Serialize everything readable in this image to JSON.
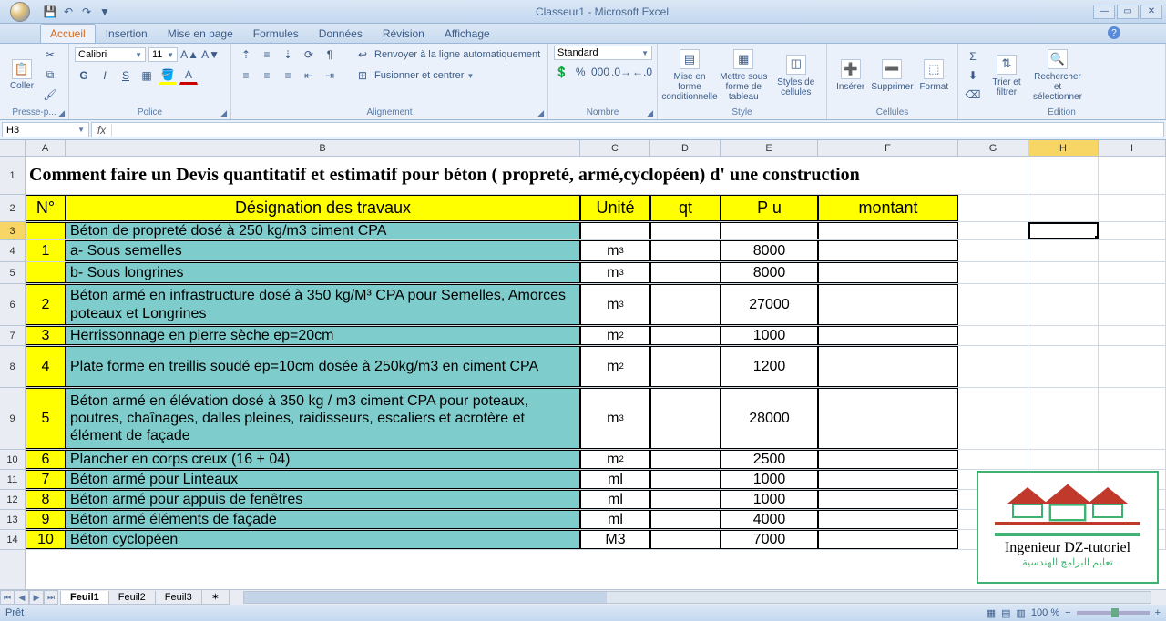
{
  "window": {
    "title": "Classeur1 - Microsoft Excel"
  },
  "qat": {
    "save": "💾",
    "undo": "↶",
    "redo": "↷"
  },
  "tabs": [
    "Accueil",
    "Insertion",
    "Mise en page",
    "Formules",
    "Données",
    "Révision",
    "Affichage"
  ],
  "active_tab": "Accueil",
  "ribbon": {
    "clipboard": {
      "paste": "Coller",
      "label": "Presse-p..."
    },
    "font": {
      "name": "Calibri",
      "size": "11",
      "label": "Police"
    },
    "align": {
      "wrap": "Renvoyer à la ligne automatiquement",
      "merge": "Fusionner et centrer",
      "label": "Alignement"
    },
    "number": {
      "format": "Standard",
      "label": "Nombre"
    },
    "style": {
      "cond": "Mise en forme conditionnelle",
      "fmt_table": "Mettre sous forme de tableau",
      "cell_styles": "Styles de cellules",
      "label": "Style"
    },
    "cells": {
      "insert": "Insérer",
      "delete": "Supprimer",
      "format": "Format",
      "label": "Cellules"
    },
    "editing": {
      "sort": "Trier et filtrer",
      "find": "Rechercher et sélectionner",
      "label": "Édition"
    }
  },
  "namebox": "H3",
  "formula": "",
  "columns": [
    "A",
    "B",
    "C",
    "D",
    "E",
    "F",
    "G",
    "H",
    "I"
  ],
  "rows": [
    "1",
    "2",
    "3",
    "4",
    "5",
    "6",
    "7",
    "8",
    "9",
    "10",
    "11",
    "12",
    "13",
    "14"
  ],
  "title_cell": "Comment faire un Devis quantitatif et estimatif pour béton ( propreté, armé,cyclopéen) d' une construction",
  "headers": {
    "no": "N°",
    "design": "Désignation des travaux",
    "unite": "Unité",
    "qt": "qt",
    "pu": "P u",
    "montant": "montant"
  },
  "data": [
    {
      "n": "",
      "d": "Béton de propreté dosé à 250 kg/m3 ciment CPA",
      "u": "",
      "qt": "",
      "pu": "",
      "m": ""
    },
    {
      "n": "1",
      "d": "a- Sous semelles",
      "u": "m³",
      "qt": "",
      "pu": "8000",
      "m": ""
    },
    {
      "n": "",
      "d": "b- Sous longrines",
      "u": "m³",
      "qt": "",
      "pu": "8000",
      "m": ""
    },
    {
      "n": "2",
      "d": "Béton armé en infrastructure dosé à 350 kg/M³ CPA pour Semelles, Amorces poteaux et Longrines",
      "u": "m³",
      "qt": "",
      "pu": "27000",
      "m": ""
    },
    {
      "n": "3",
      "d": "Herrissonnage en pierre sèche ep=20cm",
      "u": "m²",
      "qt": "",
      "pu": "1000",
      "m": ""
    },
    {
      "n": "4",
      "d": "Plate forme en treillis soudé ep=10cm dosée à 250kg/m3 en ciment CPA",
      "u": "m²",
      "qt": "",
      "pu": "1200",
      "m": ""
    },
    {
      "n": "5",
      "d": "Béton armé en élévation dosé à 350 kg / m3 ciment CPA pour poteaux, poutres, chaînages, dalles pleines, raidisseurs, escaliers et acrotère et élément de façade",
      "u": "m³",
      "qt": "",
      "pu": "28000",
      "m": ""
    },
    {
      "n": "6",
      "d": "Plancher en corps creux (16 + 04)",
      "u": "m²",
      "qt": "",
      "pu": "2500",
      "m": ""
    },
    {
      "n": "7",
      "d": "Béton armé pour Linteaux",
      "u": "ml",
      "qt": "",
      "pu": "1000",
      "m": ""
    },
    {
      "n": "8",
      "d": "Béton armé pour appuis de fenêtres",
      "u": "ml",
      "qt": "",
      "pu": "1000",
      "m": ""
    },
    {
      "n": "9",
      "d": "Béton armé éléments de façade",
      "u": "ml",
      "qt": "",
      "pu": "4000",
      "m": ""
    },
    {
      "n": "10",
      "d": "Béton  cyclopéen",
      "u": "M3",
      "qt": "",
      "pu": "7000",
      "m": ""
    }
  ],
  "sheets": [
    "Feuil1",
    "Feuil2",
    "Feuil3"
  ],
  "active_sheet": "Feuil1",
  "status": {
    "ready": "Prêt",
    "zoom": "100 %"
  },
  "logo": {
    "brand": "Ingenieur DZ-tutoriel",
    "sub": "تعليم البرامج الهندسية"
  }
}
